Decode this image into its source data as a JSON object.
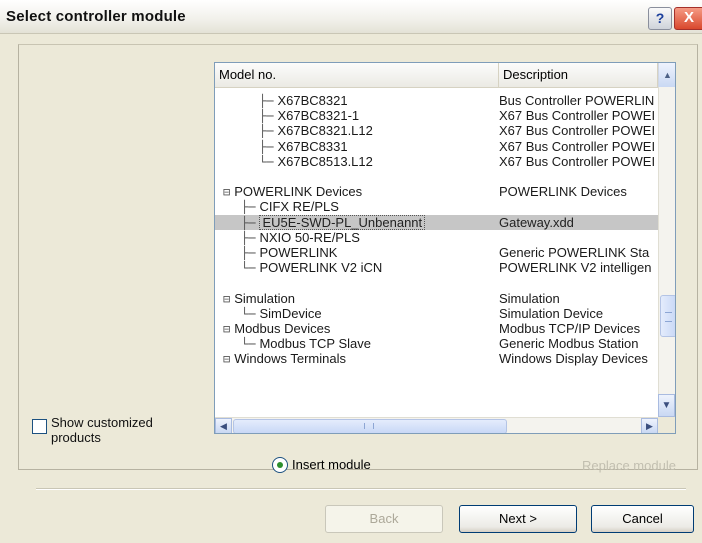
{
  "window": {
    "title": "Select controller module",
    "help_label": "?",
    "close_label": "X"
  },
  "options": {
    "show_customized_label": "Show customized products",
    "show_customized_checked": false
  },
  "list": {
    "columns": [
      "Model no.",
      "Description"
    ],
    "rows": [
      {
        "indent": 2,
        "prefix": "├─",
        "model": "X67BC8321",
        "description": "Bus Controller POWERLIN"
      },
      {
        "indent": 2,
        "prefix": "├─",
        "model": "X67BC8321-1",
        "description": "X67 Bus Controller POWEI"
      },
      {
        "indent": 2,
        "prefix": "├─",
        "model": "X67BC8321.L12",
        "description": "X67 Bus Controller POWEI"
      },
      {
        "indent": 2,
        "prefix": "├─",
        "model": "X67BC8331",
        "description": "X67 Bus Controller POWEI"
      },
      {
        "indent": 2,
        "prefix": "└─",
        "model": "X67BC8513.L12",
        "description": "X67 Bus Controller POWEI"
      },
      {
        "indent": 0,
        "prefix": "",
        "model": "",
        "description": ""
      },
      {
        "indent": 0,
        "prefix": "⊟",
        "model": "POWERLINK Devices",
        "description": "POWERLINK Devices"
      },
      {
        "indent": 1,
        "prefix": "├─",
        "model": "CIFX RE/PLS",
        "description": ""
      },
      {
        "indent": 1,
        "prefix": "├─",
        "model": "EU5E-SWD-PL_Unbenannt",
        "description": "Gateway.xdd",
        "selected": true
      },
      {
        "indent": 1,
        "prefix": "├─",
        "model": "NXIO 50-RE/PLS",
        "description": ""
      },
      {
        "indent": 1,
        "prefix": "├─",
        "model": "POWERLINK",
        "description": "Generic POWERLINK Sta"
      },
      {
        "indent": 1,
        "prefix": "└─",
        "model": "POWERLINK V2 iCN",
        "description": "POWERLINK V2 intelligen"
      },
      {
        "indent": 0,
        "prefix": "",
        "model": "",
        "description": ""
      },
      {
        "indent": 0,
        "prefix": "⊟",
        "model": "Simulation",
        "description": "Simulation"
      },
      {
        "indent": 1,
        "prefix": "└─",
        "model": "SimDevice",
        "description": "Simulation Device"
      },
      {
        "indent": 0,
        "prefix": "⊟",
        "model": "Modbus Devices",
        "description": "Modbus TCP/IP Devices"
      },
      {
        "indent": 1,
        "prefix": "└─",
        "model": "Modbus TCP Slave",
        "description": "Generic Modbus Station"
      },
      {
        "indent": 0,
        "prefix": "⊟",
        "model": "Windows Terminals",
        "description": "Windows Display Devices"
      }
    ]
  },
  "mode": {
    "insert_label": "Insert module",
    "replace_label": "Replace module",
    "selected": "insert"
  },
  "buttons": {
    "back_label": "Back",
    "next_label": "Next >",
    "cancel_label": "Cancel"
  }
}
